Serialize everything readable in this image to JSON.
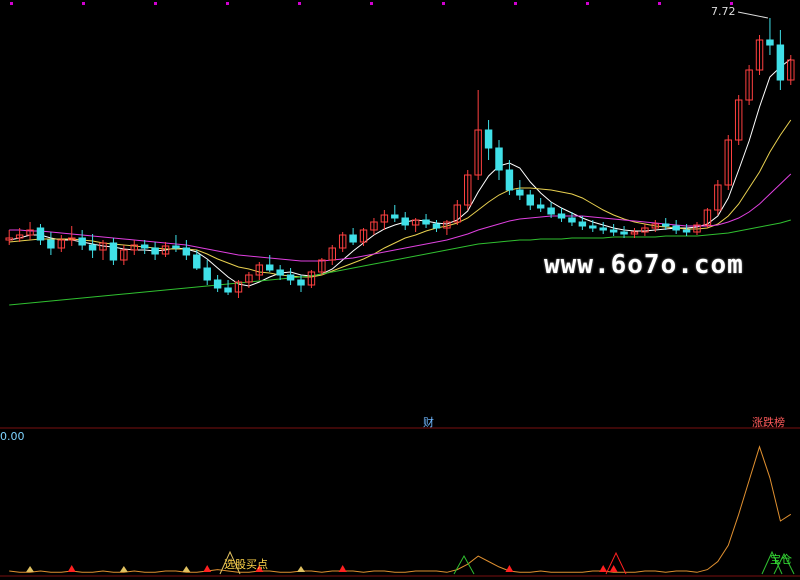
{
  "watermark": "www.6o7o.com",
  "labels": {
    "price_high": "7.72",
    "indicator_zero": "0.00",
    "marker_cai": "财",
    "marker_zhangdiebang": "涨跌榜",
    "annotation_buy": "选股买点",
    "annotation_bao": "宝仓"
  },
  "colors": {
    "background": "#000000",
    "up_candle": "#ff4040",
    "down_candle": "#40e0e8",
    "ma5": "#ffffff",
    "ma10": "#e8d050",
    "ma20": "#e040e0",
    "ma60": "#30c030",
    "indicator": "#e09030",
    "grid_dots": "#d000d0"
  },
  "chart_data": {
    "type": "candlestick",
    "series_order": [
      "open",
      "high",
      "low",
      "close"
    ],
    "price_range": [
      4.0,
      7.8
    ],
    "high_label": 7.72,
    "candles": [
      [
        5.5,
        5.6,
        5.45,
        5.52
      ],
      [
        5.52,
        5.62,
        5.48,
        5.55
      ],
      [
        5.55,
        5.68,
        5.5,
        5.6
      ],
      [
        5.62,
        5.66,
        5.45,
        5.5
      ],
      [
        5.5,
        5.58,
        5.35,
        5.42
      ],
      [
        5.42,
        5.55,
        5.38,
        5.5
      ],
      [
        5.5,
        5.64,
        5.44,
        5.52
      ],
      [
        5.52,
        5.6,
        5.4,
        5.45
      ],
      [
        5.45,
        5.56,
        5.32,
        5.4
      ],
      [
        5.4,
        5.5,
        5.3,
        5.47
      ],
      [
        5.47,
        5.52,
        5.25,
        5.3
      ],
      [
        5.3,
        5.45,
        5.25,
        5.4
      ],
      [
        5.4,
        5.5,
        5.35,
        5.45
      ],
      [
        5.45,
        5.5,
        5.36,
        5.42
      ],
      [
        5.42,
        5.48,
        5.3,
        5.36
      ],
      [
        5.36,
        5.48,
        5.33,
        5.44
      ],
      [
        5.44,
        5.55,
        5.38,
        5.42
      ],
      [
        5.42,
        5.5,
        5.3,
        5.35
      ],
      [
        5.35,
        5.4,
        5.2,
        5.22
      ],
      [
        5.22,
        5.3,
        5.05,
        5.1
      ],
      [
        5.1,
        5.15,
        4.98,
        5.02
      ],
      [
        5.02,
        5.1,
        4.95,
        4.98
      ],
      [
        4.98,
        5.1,
        4.92,
        5.08
      ],
      [
        5.08,
        5.18,
        5.02,
        5.15
      ],
      [
        5.15,
        5.28,
        5.1,
        5.25
      ],
      [
        5.25,
        5.35,
        5.18,
        5.2
      ],
      [
        5.2,
        5.25,
        5.1,
        5.15
      ],
      [
        5.15,
        5.22,
        5.05,
        5.1
      ],
      [
        5.1,
        5.15,
        4.98,
        5.05
      ],
      [
        5.05,
        5.2,
        5.02,
        5.18
      ],
      [
        5.18,
        5.32,
        5.15,
        5.3
      ],
      [
        5.3,
        5.45,
        5.25,
        5.42
      ],
      [
        5.42,
        5.58,
        5.38,
        5.55
      ],
      [
        5.55,
        5.62,
        5.45,
        5.48
      ],
      [
        5.48,
        5.62,
        5.44,
        5.6
      ],
      [
        5.6,
        5.72,
        5.55,
        5.68
      ],
      [
        5.68,
        5.8,
        5.6,
        5.75
      ],
      [
        5.75,
        5.85,
        5.68,
        5.72
      ],
      [
        5.72,
        5.78,
        5.6,
        5.65
      ],
      [
        5.65,
        5.72,
        5.58,
        5.7
      ],
      [
        5.7,
        5.76,
        5.62,
        5.66
      ],
      [
        5.66,
        5.7,
        5.58,
        5.62
      ],
      [
        5.62,
        5.7,
        5.55,
        5.68
      ],
      [
        5.68,
        5.9,
        5.65,
        5.85
      ],
      [
        5.85,
        6.2,
        5.8,
        6.15
      ],
      [
        6.15,
        7.0,
        6.1,
        6.6
      ],
      [
        6.6,
        6.7,
        6.3,
        6.42
      ],
      [
        6.42,
        6.5,
        6.1,
        6.2
      ],
      [
        6.2,
        6.3,
        5.95,
        6.0
      ],
      [
        6.0,
        6.1,
        5.9,
        5.95
      ],
      [
        5.95,
        6.0,
        5.8,
        5.85
      ],
      [
        5.85,
        5.92,
        5.78,
        5.82
      ],
      [
        5.82,
        5.88,
        5.72,
        5.76
      ],
      [
        5.76,
        5.82,
        5.68,
        5.72
      ],
      [
        5.72,
        5.78,
        5.64,
        5.68
      ],
      [
        5.68,
        5.74,
        5.6,
        5.64
      ],
      [
        5.64,
        5.7,
        5.58,
        5.62
      ],
      [
        5.62,
        5.68,
        5.56,
        5.6
      ],
      [
        5.6,
        5.66,
        5.54,
        5.58
      ],
      [
        5.58,
        5.64,
        5.52,
        5.56
      ],
      [
        5.56,
        5.62,
        5.52,
        5.58
      ],
      [
        5.58,
        5.66,
        5.54,
        5.62
      ],
      [
        5.62,
        5.7,
        5.58,
        5.66
      ],
      [
        5.66,
        5.72,
        5.6,
        5.64
      ],
      [
        5.64,
        5.7,
        5.56,
        5.6
      ],
      [
        5.6,
        5.66,
        5.54,
        5.58
      ],
      [
        5.58,
        5.68,
        5.55,
        5.65
      ],
      [
        5.65,
        5.82,
        5.62,
        5.8
      ],
      [
        5.8,
        6.1,
        5.75,
        6.05
      ],
      [
        6.05,
        6.55,
        6.0,
        6.5
      ],
      [
        6.5,
        6.95,
        6.45,
        6.9
      ],
      [
        6.9,
        7.25,
        6.85,
        7.2
      ],
      [
        7.2,
        7.55,
        7.15,
        7.5
      ],
      [
        7.5,
        7.72,
        7.35,
        7.45
      ],
      [
        7.45,
        7.6,
        7.0,
        7.1
      ],
      [
        7.1,
        7.35,
        7.05,
        7.3
      ]
    ],
    "moving_averages": [
      {
        "name": "MA5",
        "color": "#ffffff",
        "values": [
          5.5,
          5.52,
          5.55,
          5.55,
          5.52,
          5.5,
          5.5,
          5.48,
          5.46,
          5.44,
          5.43,
          5.41,
          5.4,
          5.4,
          5.39,
          5.4,
          5.42,
          5.41,
          5.38,
          5.31,
          5.22,
          5.13,
          5.06,
          5.04,
          5.08,
          5.13,
          5.17,
          5.18,
          5.15,
          5.14,
          5.16,
          5.21,
          5.3,
          5.39,
          5.47,
          5.55,
          5.61,
          5.65,
          5.68,
          5.7,
          5.69,
          5.67,
          5.66,
          5.7,
          5.79,
          5.98,
          6.14,
          6.24,
          6.27,
          6.22,
          6.08,
          5.97,
          5.88,
          5.82,
          5.77,
          5.72,
          5.68,
          5.65,
          5.62,
          5.6,
          5.59,
          5.59,
          5.6,
          5.61,
          5.62,
          5.62,
          5.63,
          5.66,
          5.74,
          5.92,
          6.2,
          6.49,
          6.83,
          7.13,
          7.23,
          7.31
        ]
      },
      {
        "name": "MA10",
        "color": "#e8d050",
        "values": [
          5.48,
          5.49,
          5.5,
          5.51,
          5.51,
          5.51,
          5.51,
          5.5,
          5.49,
          5.47,
          5.46,
          5.45,
          5.44,
          5.43,
          5.42,
          5.41,
          5.41,
          5.41,
          5.4,
          5.36,
          5.31,
          5.27,
          5.23,
          5.21,
          5.18,
          5.17,
          5.15,
          5.14,
          5.13,
          5.13,
          5.15,
          5.19,
          5.23,
          5.27,
          5.31,
          5.36,
          5.42,
          5.47,
          5.52,
          5.55,
          5.59,
          5.62,
          5.64,
          5.67,
          5.72,
          5.8,
          5.88,
          5.95,
          6.0,
          6.02,
          6.02,
          6.01,
          6.0,
          5.98,
          5.96,
          5.92,
          5.86,
          5.8,
          5.75,
          5.71,
          5.68,
          5.66,
          5.64,
          5.63,
          5.62,
          5.61,
          5.61,
          5.62,
          5.66,
          5.74,
          5.86,
          6.02,
          6.18,
          6.38,
          6.55,
          6.7
        ]
      },
      {
        "name": "MA20",
        "color": "#e040e0",
        "values": [
          5.6,
          5.6,
          5.59,
          5.59,
          5.58,
          5.57,
          5.56,
          5.55,
          5.54,
          5.53,
          5.52,
          5.51,
          5.5,
          5.49,
          5.48,
          5.47,
          5.46,
          5.45,
          5.43,
          5.41,
          5.39,
          5.37,
          5.35,
          5.34,
          5.33,
          5.32,
          5.31,
          5.3,
          5.29,
          5.29,
          5.29,
          5.3,
          5.31,
          5.32,
          5.34,
          5.36,
          5.38,
          5.4,
          5.42,
          5.44,
          5.46,
          5.48,
          5.5,
          5.53,
          5.56,
          5.6,
          5.63,
          5.66,
          5.69,
          5.71,
          5.72,
          5.73,
          5.74,
          5.74,
          5.74,
          5.74,
          5.73,
          5.72,
          5.71,
          5.7,
          5.69,
          5.68,
          5.67,
          5.66,
          5.65,
          5.64,
          5.64,
          5.64,
          5.65,
          5.68,
          5.72,
          5.78,
          5.86,
          5.96,
          6.06,
          6.16
        ]
      },
      {
        "name": "MA60",
        "color": "#30c030",
        "values": [
          4.85,
          4.86,
          4.87,
          4.88,
          4.89,
          4.9,
          4.91,
          4.92,
          4.93,
          4.94,
          4.95,
          4.96,
          4.97,
          4.98,
          4.99,
          5.0,
          5.01,
          5.02,
          5.03,
          5.04,
          5.05,
          5.06,
          5.07,
          5.08,
          5.09,
          5.1,
          5.11,
          5.12,
          5.13,
          5.14,
          5.16,
          5.18,
          5.2,
          5.22,
          5.24,
          5.26,
          5.28,
          5.3,
          5.32,
          5.34,
          5.36,
          5.38,
          5.4,
          5.42,
          5.44,
          5.46,
          5.47,
          5.48,
          5.49,
          5.5,
          5.5,
          5.51,
          5.51,
          5.51,
          5.52,
          5.52,
          5.52,
          5.52,
          5.53,
          5.53,
          5.53,
          5.53,
          5.53,
          5.54,
          5.54,
          5.54,
          5.54,
          5.55,
          5.56,
          5.57,
          5.59,
          5.61,
          5.63,
          5.65,
          5.67,
          5.7
        ]
      }
    ],
    "indicator": {
      "name": "",
      "color": "#e09030",
      "range": [
        0,
        100
      ],
      "values": [
        3,
        2,
        2,
        3,
        2,
        2,
        3,
        2,
        2,
        3,
        2,
        2,
        3,
        2,
        2,
        3,
        3,
        2,
        2,
        3,
        4,
        3,
        2,
        2,
        3,
        3,
        2,
        2,
        3,
        3,
        2,
        3,
        3,
        3,
        2,
        3,
        3,
        2,
        2,
        3,
        3,
        3,
        2,
        4,
        8,
        14,
        10,
        6,
        3,
        2,
        2,
        3,
        2,
        2,
        2,
        2,
        3,
        3,
        2,
        2,
        2,
        3,
        3,
        2,
        3,
        3,
        2,
        4,
        10,
        22,
        45,
        70,
        95,
        72,
        40,
        45
      ]
    },
    "signal_markers": {
      "red_up": [
        6,
        19,
        24,
        32,
        48,
        57,
        58
      ],
      "yellow_small": [
        2,
        11,
        17,
        28
      ]
    }
  }
}
